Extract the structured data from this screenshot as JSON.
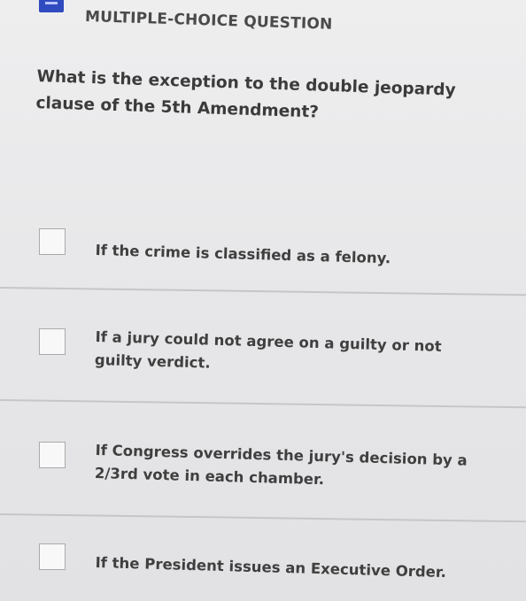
{
  "header": {
    "label": "MULTIPLE-CHOICE QUESTION"
  },
  "question": {
    "text": "What is the exception to the double jeopardy clause of the 5th Amendment?"
  },
  "options": [
    {
      "label": "If the crime is classified as a felony."
    },
    {
      "label": "If a jury could not agree on a guilty or not guilty verdict."
    },
    {
      "label": "If Congress overrides the jury's decision by a 2/3rd vote in each chamber."
    },
    {
      "label": "If the President issues an Executive Order."
    }
  ],
  "colors": {
    "accent": "#2f4bbf",
    "background": "#e7e7e9",
    "text": "#3b3b3b",
    "divider": "#c6c6c8"
  }
}
